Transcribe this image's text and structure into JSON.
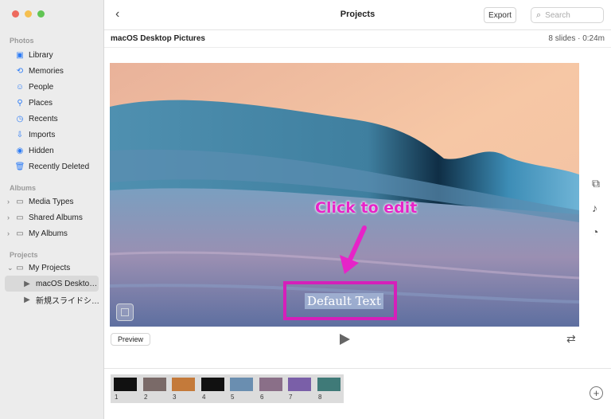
{
  "sidebar": {
    "sections": {
      "photos": "Photos",
      "albums": "Albums",
      "projects": "Projects"
    },
    "photos_items": [
      {
        "label": "Library",
        "icon": "library-icon"
      },
      {
        "label": "Memories",
        "icon": "memories-icon"
      },
      {
        "label": "People",
        "icon": "people-icon"
      },
      {
        "label": "Places",
        "icon": "places-icon"
      },
      {
        "label": "Recents",
        "icon": "recents-icon"
      },
      {
        "label": "Imports",
        "icon": "imports-icon"
      },
      {
        "label": "Hidden",
        "icon": "hidden-icon"
      },
      {
        "label": "Recently Deleted",
        "icon": "trash-icon"
      }
    ],
    "albums_items": [
      {
        "label": "Media Types",
        "icon": "folder-icon"
      },
      {
        "label": "Shared Albums",
        "icon": "folder-icon"
      },
      {
        "label": "My Albums",
        "icon": "folder-icon"
      }
    ],
    "projects_items": [
      {
        "label": "My Projects",
        "icon": "folder-icon"
      },
      {
        "label": "macOS Deskto…",
        "icon": "slideshow-icon",
        "selected": true
      },
      {
        "label": "新規スライドシ…",
        "icon": "slideshow-icon"
      }
    ]
  },
  "header": {
    "title": "Projects",
    "export_label": "Export",
    "search_placeholder": "Search"
  },
  "project": {
    "name": "macOS Desktop Pictures",
    "info": "8 slides · 0:24m"
  },
  "stage": {
    "annotation": "Click to edit",
    "default_text": "Default Text"
  },
  "controls": {
    "preview_label": "Preview"
  },
  "filmstrip": [
    {
      "num": "1",
      "color": "#111111",
      "title": true
    },
    {
      "num": "2",
      "color": "#7a6a68"
    },
    {
      "num": "3",
      "color": "#c47a3a"
    },
    {
      "num": "4",
      "color": "#111111",
      "title": true
    },
    {
      "num": "5",
      "color": "#6a8eb0"
    },
    {
      "num": "6",
      "color": "#8a6f88"
    },
    {
      "num": "7",
      "color": "#7a5fa8"
    },
    {
      "num": "8",
      "color": "#3f7a78"
    }
  ],
  "colors": {
    "accent": "#2d7cf6",
    "annotation": "#e624c8",
    "frame": "#d51fba"
  }
}
